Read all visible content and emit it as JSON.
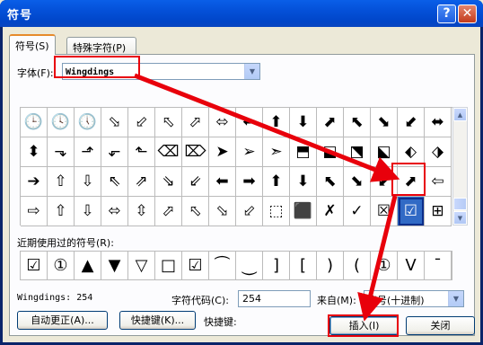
{
  "window": {
    "title": "符号",
    "help_glyph": "?",
    "close_glyph": "✕"
  },
  "tabs": [
    {
      "label": "符号(S)",
      "active": true
    },
    {
      "label": "特殊字符(P)",
      "active": false
    }
  ],
  "font": {
    "label": "字体(F):",
    "value": "Wingdings"
  },
  "symbol_grid": [
    [
      "🕒",
      "🕓",
      "🕔",
      "⬂",
      "⬃",
      "⬁",
      "⬀",
      "⬄",
      "⬅",
      "⬆",
      "⬇",
      "⬈",
      "⬉",
      "⬊",
      "⬋",
      "⬌"
    ],
    [
      "⬍",
      "⬎",
      "⬏",
      "⬐",
      "⬑",
      "⌫",
      "⌦",
      "➤",
      "➢",
      "➣",
      "⬒",
      "⬓",
      "⬔",
      "⬕",
      "⬖",
      "⬗"
    ],
    [
      "➔",
      "⇧",
      "⇩",
      "⇖",
      "⇗",
      "⇘",
      "⇙",
      "⬅",
      "➡",
      "⬆",
      "⬇",
      "⬉",
      "⬊",
      "⬋",
      "⬈",
      "⇦"
    ],
    [
      "⇨",
      "⇧",
      "⇩",
      "⬄",
      "⇳",
      "⬀",
      "⬁",
      "⬂",
      "⬃",
      "⬚",
      "⬛",
      "✗",
      "✓",
      "☒",
      "☑",
      "⊞"
    ]
  ],
  "selected_cell": {
    "row": 3,
    "col": 14
  },
  "recent": {
    "label": "近期使用过的符号(R):",
    "symbols": [
      "☑",
      "①",
      "▲",
      "▼",
      "▽",
      "□",
      "☑",
      "⏜",
      "⏝",
      "]",
      "[",
      ")",
      "(",
      "①",
      "V",
      "¯"
    ]
  },
  "status": {
    "char_name": "Wingdings: 254",
    "char_code_label": "字符代码(C):",
    "char_code_value": "254",
    "from_label": "来自(M):",
    "from_value": "符号(十进制)"
  },
  "buttons": {
    "autocorrect": "自动更正(A)...",
    "shortcut": "快捷键(K)...",
    "shortcut_key_label": "快捷键:",
    "insert": "插入(I)",
    "close": "关闭"
  },
  "icons": {
    "scroll_up": "▲",
    "scroll_down": "▼",
    "combo_arrow": "▼"
  },
  "colors": {
    "annotation": "#e8000b",
    "selection": "#316ac5"
  }
}
